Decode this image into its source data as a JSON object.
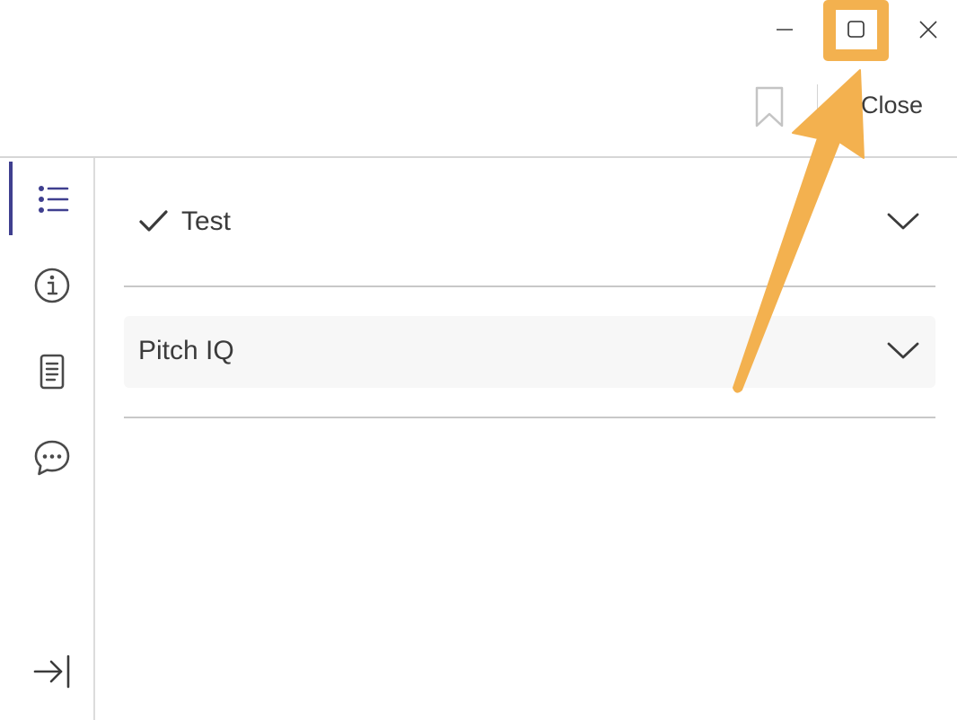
{
  "window": {
    "minimize_icon": "minimize-icon",
    "maximize_icon": "maximize-icon",
    "close_icon": "close-icon"
  },
  "toolbar": {
    "bookmark_icon": "bookmark-icon",
    "close_label": "Close"
  },
  "sidebar": {
    "items": [
      {
        "icon": "list-icon",
        "active": true
      },
      {
        "icon": "info-icon",
        "active": false
      },
      {
        "icon": "document-icon",
        "active": false
      },
      {
        "icon": "chat-icon",
        "active": false
      }
    ],
    "collapse_icon": "collapse-panel-icon"
  },
  "sections": [
    {
      "label": "Test",
      "checked": true,
      "icon": "check-icon"
    },
    {
      "label": "Pitch IQ",
      "checked": false
    }
  ],
  "annotation": {
    "highlight_color": "#f3b14f",
    "arrow_color": "#f3b14f"
  },
  "colors": {
    "accent": "#3f3f8f",
    "text": "#3b3b3b"
  }
}
